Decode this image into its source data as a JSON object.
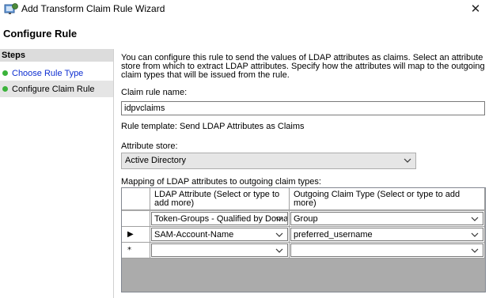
{
  "window": {
    "title": "Add Transform Claim Rule Wizard",
    "close_glyph": "✕"
  },
  "page": {
    "heading": "Configure Rule"
  },
  "steps": {
    "title": "Steps",
    "items": [
      {
        "label": "Choose Rule Type",
        "status_color": "#3bb33b",
        "link_color": "#0e2fd1"
      },
      {
        "label": "Configure Claim Rule",
        "status_color": "#3bb33b",
        "selected": true
      }
    ]
  },
  "main": {
    "description": "You can configure this rule to send the values of LDAP attributes as claims. Select an attribute store from which to extract LDAP attributes. Specify how the attributes will map to the outgoing claim types that will be issued from the rule.",
    "rule_name_label": "Claim rule name:",
    "rule_name_value": "idpvclaims",
    "rule_template": "Rule template: Send LDAP Attributes as Claims",
    "attribute_store_label": "Attribute store:",
    "attribute_store_value": "Active Directory",
    "mapping_label": "Mapping of LDAP attributes to outgoing claim types:"
  },
  "mapping_grid": {
    "columns": [
      "LDAP Attribute (Select or type to add more)",
      "Outgoing Claim Type (Select or type to add more)"
    ],
    "rows": [
      {
        "marker": "",
        "ldap": "Token-Groups - Qualified by Doma...",
        "claim": "Group"
      },
      {
        "marker": "▶",
        "ldap": "SAM-Account-Name",
        "claim": "preferred_username"
      },
      {
        "marker": "*",
        "ldap": "",
        "claim": ""
      }
    ]
  },
  "icons": {
    "app": "wizard-icon",
    "dropdown": "chevron-down-icon",
    "close": "close-icon"
  },
  "colors": {
    "step_link": "#0e2fd1",
    "status_dot": "#3bb33b",
    "selected_step_bg": "#e5e5e5",
    "grid_empty_bg": "#ababab"
  }
}
